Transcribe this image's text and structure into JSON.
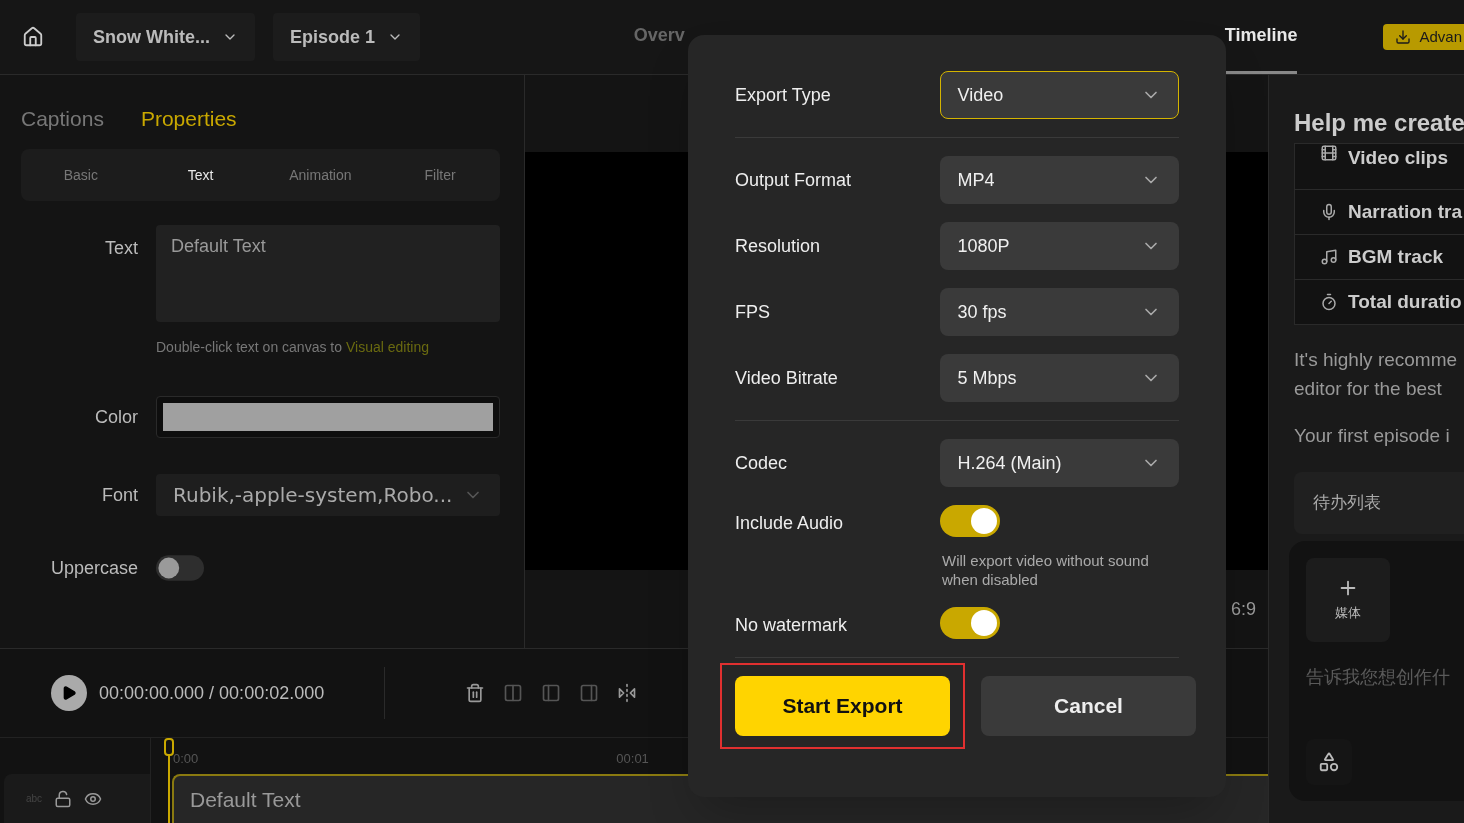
{
  "top_bar": {
    "project": "Snow White...",
    "episode": "Episode 1",
    "nav": [
      {
        "label": "Overv",
        "selected": false
      },
      {
        "label": "Timeline",
        "selected": true
      }
    ],
    "action_button": "Advan"
  },
  "left_panel": {
    "tabs": [
      {
        "label": "Captions",
        "selected": false
      },
      {
        "label": "Properties",
        "selected": true
      }
    ],
    "subtabs": [
      {
        "label": "Basic",
        "selected": false
      },
      {
        "label": "Text",
        "selected": true
      },
      {
        "label": "Animation",
        "selected": false
      },
      {
        "label": "Filter",
        "selected": false
      }
    ],
    "text_label": "Text",
    "text_value": "Default Text",
    "hint": "Double-click text on canvas to",
    "hint_link": "Visual editing",
    "color_label": "Color",
    "color": "#a0a0a0",
    "font_label": "Font",
    "font_value": "Rubik,-apple-system,Robo...",
    "uppercase_label": "Uppercase",
    "uppercase_on": false
  },
  "preview": {
    "aspect": "6:9"
  },
  "timeline": {
    "time": "00:00:00.000 / 00:00:02.000",
    "ruler": [
      "0:00",
      "00:01"
    ],
    "track_label": "abc",
    "clip": "Default Text"
  },
  "export_dialog": {
    "groups": [
      [
        {
          "kind": "select",
          "label": "Export Type",
          "value": "Video",
          "focused": true
        }
      ],
      [
        {
          "kind": "select",
          "label": "Output Format",
          "value": "MP4",
          "focused": false
        },
        {
          "kind": "select",
          "label": "Resolution",
          "value": "1080P",
          "focused": false
        },
        {
          "kind": "select",
          "label": "FPS",
          "value": "30 fps",
          "focused": false
        },
        {
          "kind": "select",
          "label": "Video Bitrate",
          "value": "5 Mbps",
          "focused": false
        }
      ],
      [
        {
          "kind": "select",
          "label": "Codec",
          "value": "H.264 (Main)",
          "focused": false
        },
        {
          "kind": "toggle",
          "label": "Include Audio",
          "on": true,
          "hint": "Will export video without sound when disabled"
        },
        {
          "kind": "toggle",
          "label": "No watermark",
          "on": true
        }
      ]
    ],
    "buttons": [
      {
        "kind": "primary",
        "label": "Start Export",
        "highlighted": true
      },
      {
        "kind": "secondary",
        "label": "Cancel",
        "highlighted": false
      }
    ]
  },
  "right_panel": {
    "title": "Help me create",
    "checklist": [
      {
        "kind": "clips",
        "label": "Video clips"
      },
      {
        "kind": "mic",
        "label": "Narration tra"
      },
      {
        "kind": "music",
        "label": "BGM track"
      },
      {
        "kind": "timer",
        "label": "Total duratio"
      }
    ],
    "paragraphs": [
      "It's highly recomme editor for the best",
      "Your first episode i"
    ],
    "todo": "待办列表",
    "media_button": "媒体",
    "chat_placeholder": "告诉我您想创作什"
  }
}
